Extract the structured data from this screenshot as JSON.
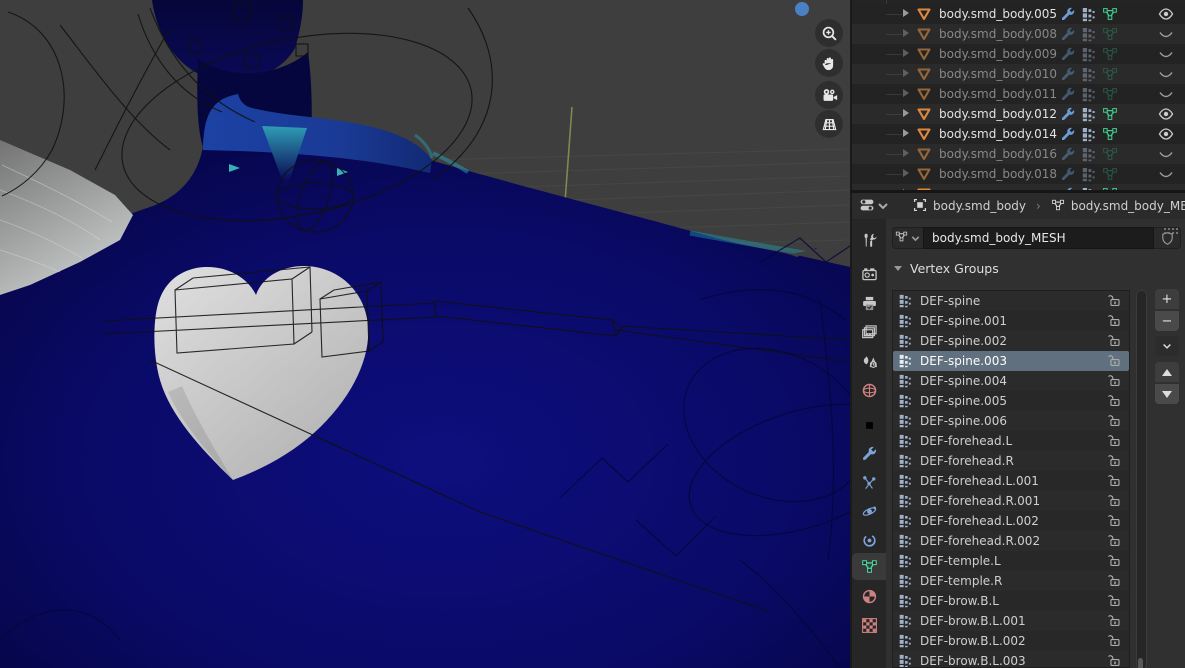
{
  "viewport": {
    "nav_gizmos": [
      {
        "name": "zoom-gizmo",
        "icon": "magnifier-plus-icon"
      },
      {
        "name": "pan-gizmo",
        "icon": "hand-icon"
      },
      {
        "name": "camera-view-gizmo",
        "icon": "camera-icon"
      },
      {
        "name": "perspective-gizmo",
        "icon": "grid-icon"
      }
    ],
    "colors": {
      "background": "#3e3e3e",
      "weight_paint_blue": "#0b0b74",
      "collar_blue": "#1f45a0",
      "notch_teal": "#2f9db5",
      "heart_grey": "#cdcdcd",
      "hair_grey": "#b0b4b4",
      "axis_green": "#7b8b4d",
      "gizmo_dot_blue": "#4a80c4"
    }
  },
  "outliner": {
    "row_icons": [
      "mesh-object-icon",
      "modifier-wrench-icon",
      "vertex-group-icon",
      "mesh-data-icon"
    ],
    "visibility_icons": {
      "visible": "eye-icon",
      "hidden": "eye-closed-icon"
    },
    "rows": [
      {
        "name": "body.smd_body.005",
        "visible": true
      },
      {
        "name": "body.smd_body.008",
        "visible": false
      },
      {
        "name": "body.smd_body.009",
        "visible": false
      },
      {
        "name": "body.smd_body.010",
        "visible": false
      },
      {
        "name": "body.smd_body.011",
        "visible": false
      },
      {
        "name": "body.smd_body.012",
        "visible": true
      },
      {
        "name": "body.smd_body.014",
        "visible": true
      },
      {
        "name": "body.smd_body.016",
        "visible": false
      },
      {
        "name": "body.smd_body.018",
        "visible": false
      },
      {
        "name": "",
        "visible": true,
        "partial": true
      }
    ]
  },
  "properties": {
    "header": {
      "editor_icon": "properties-editor-icon",
      "object_icon": "object-icon",
      "object_name": "body.smd_body",
      "separator": "›",
      "data_icon": "mesh-data-icon",
      "data_name": "body.smd_body_MESH"
    },
    "name_field": {
      "icon": "mesh-data-icon",
      "value": "body.smd_body_MESH",
      "shield_icon": "shield-icon"
    },
    "tabs": [
      {
        "name": "tool",
        "active": false
      },
      {
        "name": "render",
        "active": false
      },
      {
        "name": "output",
        "active": false
      },
      {
        "name": "view-layer",
        "active": false
      },
      {
        "name": "scene",
        "active": false
      },
      {
        "name": "world",
        "active": false
      },
      {
        "name": "object",
        "active": false
      },
      {
        "name": "modifiers",
        "active": false
      },
      {
        "name": "particles",
        "active": false
      },
      {
        "name": "physics",
        "active": false
      },
      {
        "name": "constraints",
        "active": false
      },
      {
        "name": "object-data",
        "active": true
      },
      {
        "name": "material",
        "active": false
      },
      {
        "name": "texture",
        "active": false
      }
    ],
    "panel": {
      "title": "Vertex Groups"
    },
    "vertex_groups": {
      "selected": "DEF-spine.003",
      "row_icon": "vertex-group-icon",
      "lock_icon": "lock-open-icon",
      "toolbar": [
        {
          "name": "add-vertex-group",
          "glyph": "+"
        },
        {
          "name": "remove-vertex-group",
          "glyph": "−"
        },
        {
          "name": "vertex-group-specials",
          "glyph": "v"
        },
        {
          "name": "move-group-up",
          "glyph": "▲"
        },
        {
          "name": "move-group-down",
          "glyph": "▼"
        }
      ],
      "items": [
        {
          "name": "DEF-spine"
        },
        {
          "name": "DEF-spine.001"
        },
        {
          "name": "DEF-spine.002"
        },
        {
          "name": "DEF-spine.003",
          "selected": true
        },
        {
          "name": "DEF-spine.004"
        },
        {
          "name": "DEF-spine.005"
        },
        {
          "name": "DEF-spine.006"
        },
        {
          "name": "DEF-forehead.L"
        },
        {
          "name": "DEF-forehead.R"
        },
        {
          "name": "DEF-forehead.L.001"
        },
        {
          "name": "DEF-forehead.R.001"
        },
        {
          "name": "DEF-forehead.L.002"
        },
        {
          "name": "DEF-forehead.R.002"
        },
        {
          "name": "DEF-temple.L"
        },
        {
          "name": "DEF-temple.R"
        },
        {
          "name": "DEF-brow.B.L"
        },
        {
          "name": "DEF-brow.B.L.001"
        },
        {
          "name": "DEF-brow.B.L.002"
        },
        {
          "name": "DEF-brow.B.L.003"
        }
      ]
    }
  }
}
